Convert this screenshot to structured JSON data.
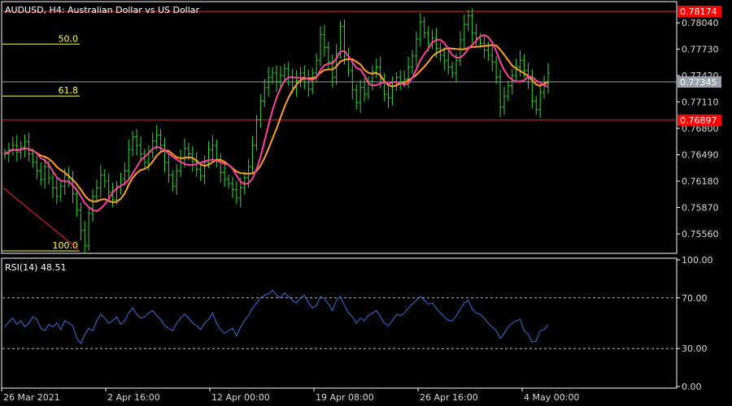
{
  "chart_data": [
    {
      "type": "candlestick",
      "header": "AUDUSD, H4:  Australian Dollar vs US Dollar",
      "price_axis_ticks": [
        "0.78040",
        "0.77730",
        "0.77420",
        "0.77110",
        "0.76800",
        "0.76490",
        "0.76180",
        "0.75870",
        "0.75560"
      ],
      "y_range": [
        0.7535,
        0.7827
      ],
      "time_labels": [
        "26 Mar 2021",
        "2 Apr 16:00",
        "12 Apr 00:00",
        "19 Apr 08:00",
        "26 Apr 16:00",
        "4 May 00:00"
      ],
      "price_levels": [
        {
          "value": 0.78174,
          "label": "0.78174",
          "line_color": "#ff2020",
          "badge_color": "#ff0000"
        },
        {
          "value": 0.77345,
          "label": "0.77345",
          "line_color": "#9aa3ad",
          "badge_color": "#9aa3ad"
        },
        {
          "value": 0.76897,
          "label": "0.76897",
          "line_color": "#ff2020",
          "badge_color": "#ff0000"
        }
      ],
      "fibonacci": [
        {
          "label": "50.0",
          "value": 0.7779
        },
        {
          "label": "61.8",
          "value": 0.7718
        },
        {
          "label": "100.0",
          "value": 0.7536
        }
      ],
      "close_series": [
        0.765,
        0.7655,
        0.766,
        0.7652,
        0.7658,
        0.7664,
        0.765,
        0.764,
        0.763,
        0.762,
        0.7635,
        0.7622,
        0.761,
        0.76,
        0.7612,
        0.7625,
        0.7618,
        0.7603,
        0.7584,
        0.756,
        0.7542,
        0.758,
        0.76,
        0.761,
        0.7625,
        0.7618,
        0.7605,
        0.7596,
        0.7612,
        0.762,
        0.763,
        0.7655,
        0.767,
        0.766,
        0.765,
        0.764,
        0.7652,
        0.7665,
        0.7672,
        0.766,
        0.764,
        0.7625,
        0.7612,
        0.763,
        0.7645,
        0.7656,
        0.765,
        0.7641,
        0.7632,
        0.7624,
        0.764,
        0.7655,
        0.766,
        0.7642,
        0.7628,
        0.762,
        0.7615,
        0.7608,
        0.7598,
        0.761,
        0.7622,
        0.7635,
        0.766,
        0.769,
        0.7712,
        0.7728,
        0.774,
        0.7745,
        0.7735,
        0.7742,
        0.775,
        0.774,
        0.7728,
        0.7736,
        0.7745,
        0.7738,
        0.7726,
        0.7745,
        0.776,
        0.779,
        0.7775,
        0.7758,
        0.774,
        0.7768,
        0.78,
        0.7765,
        0.7748,
        0.7725,
        0.771,
        0.7728,
        0.772,
        0.7735,
        0.7746,
        0.7752,
        0.7738,
        0.772,
        0.7716,
        0.773,
        0.774,
        0.7735,
        0.7738,
        0.7752,
        0.7765,
        0.7785,
        0.7805,
        0.7792,
        0.778,
        0.7786,
        0.7774,
        0.7766,
        0.776,
        0.7752,
        0.7745,
        0.776,
        0.7784,
        0.7802,
        0.7812,
        0.7792,
        0.7786,
        0.778,
        0.7772,
        0.7766,
        0.7758,
        0.774,
        0.7705,
        0.7718,
        0.773,
        0.7742,
        0.7752,
        0.776,
        0.7748,
        0.7738,
        0.7712,
        0.7702,
        0.7722,
        0.7732,
        0.7745
      ],
      "ma_fast_color": "#ff40a0",
      "ma_slow_color": "#ffa020",
      "candle_color": "#33d633"
    },
    {
      "type": "line",
      "header": "RSI(14) 48.51",
      "y_range": [
        0,
        100
      ],
      "y_ticks": [
        "100.00",
        "70.00",
        "30.00",
        "0.00"
      ],
      "levels": [
        70,
        30
      ],
      "line_color": "#3b6fe0",
      "values": [
        47,
        51,
        54,
        49,
        52,
        47,
        50,
        55,
        53,
        46,
        44,
        49,
        47,
        50,
        45,
        52,
        50,
        48,
        38,
        34,
        41,
        46,
        44,
        52,
        57,
        54,
        50,
        52,
        55,
        49,
        52,
        58,
        62,
        57,
        54,
        55,
        58,
        60,
        56,
        53,
        48,
        46,
        44,
        50,
        54,
        57,
        54,
        50,
        48,
        45,
        50,
        53,
        58,
        50,
        45,
        42,
        44,
        46,
        40,
        47,
        52,
        56,
        62,
        66,
        70,
        72,
        73,
        76,
        72,
        70,
        74,
        71,
        68,
        66,
        70,
        72,
        66,
        62,
        64,
        71,
        69,
        65,
        60,
        68,
        71,
        64,
        58,
        55,
        50,
        54,
        52,
        56,
        58,
        60,
        55,
        50,
        48,
        52,
        57,
        56,
        58,
        62,
        65,
        68,
        71,
        68,
        65,
        66,
        62,
        58,
        55,
        52,
        52,
        56,
        61,
        66,
        68,
        61,
        58,
        57,
        54,
        50,
        47,
        44,
        38,
        42,
        47,
        50,
        52,
        53,
        44,
        41,
        35,
        36,
        44,
        45,
        49
      ]
    }
  ]
}
